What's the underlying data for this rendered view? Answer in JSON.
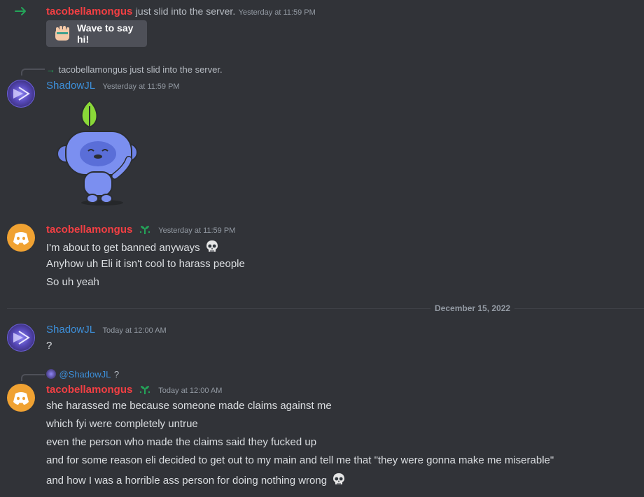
{
  "join": {
    "username": "tacobellamongus",
    "text": "just slid into the server.",
    "timestamp": "Yesterday at 11:59 PM",
    "wave_label": "Wave to say hi!"
  },
  "msg1": {
    "reply_text": "tacobellamongus just slid into the server.",
    "username": "ShadowJL",
    "timestamp": "Yesterday at 11:59 PM"
  },
  "msg2": {
    "username": "tacobellamongus",
    "timestamp": "Yesterday at 11:59 PM",
    "lines": [
      "I'm about to get banned anyways",
      "Anyhow uh Eli it isn't cool to harass people",
      "So uh yeah"
    ]
  },
  "date_divider": "December 15, 2022",
  "msg3": {
    "username": "ShadowJL",
    "timestamp": "Today at 12:00 AM",
    "text": "?"
  },
  "msg4": {
    "reply_mention": "@ShadowJL",
    "reply_text": "?",
    "username": "tacobellamongus",
    "timestamp": "Today at 12:00 AM",
    "lines": [
      "she harassed me because someone made claims against me",
      "which fyi were completely untrue",
      "even the person who made the claims said they fucked up",
      "and for some reason eli decided to get out to my main and tell me that \"they were gonna make me miserable\"",
      "and how I was a horrible ass person for doing nothing wrong"
    ]
  },
  "colors": {
    "background": "#313338",
    "username_red": "#f23f43",
    "username_blue": "#3d8fd9",
    "join_arrow": "#23a559",
    "discord_avatar": "#f0a232"
  }
}
